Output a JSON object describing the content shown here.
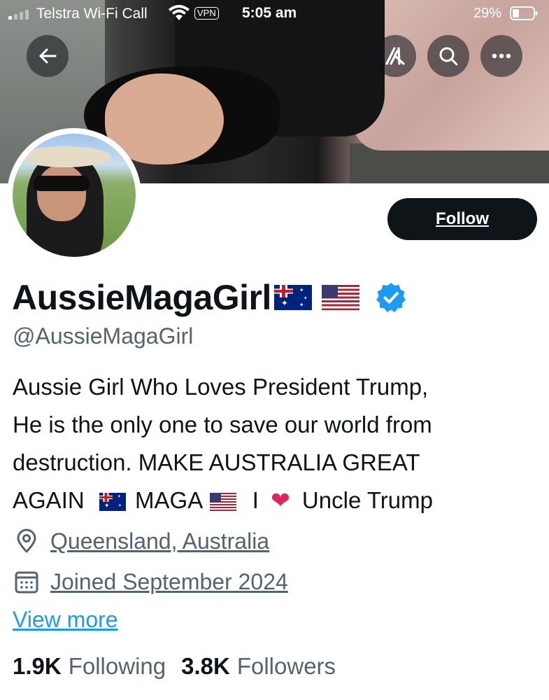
{
  "status_bar": {
    "carrier": "Telstra Wi-Fi Call",
    "vpn": "VPN",
    "time": "5:05 am",
    "battery": "29%"
  },
  "header": {
    "icons": [
      "back-arrow-icon",
      "grok-icon",
      "search-icon",
      "more-icon"
    ]
  },
  "profile": {
    "display_name": "AussieMagaGirl",
    "handle": "@AussieMagaGirl",
    "follow_label": "Follow",
    "verified": true,
    "bio_lines": [
      "Aussie Girl Who Loves President Trump,",
      "He is the only one to save our world from",
      "destruction. MAKE AUSTRALIA GREAT",
      "AGAIN",
      "MAGA",
      "I",
      "Uncle Trump"
    ],
    "location": "Queensland, Australia",
    "joined": "Joined September 2024",
    "view_more": "View more",
    "following_count": "1.9K",
    "following_label": "Following",
    "followers_count": "3.8K",
    "followers_label": "Followers"
  },
  "colors": {
    "accent": "#1d9bf0",
    "text": "#0f1419",
    "secondary_text": "#536471",
    "button_bg": "#0f1419",
    "heart": "#e0245e"
  }
}
